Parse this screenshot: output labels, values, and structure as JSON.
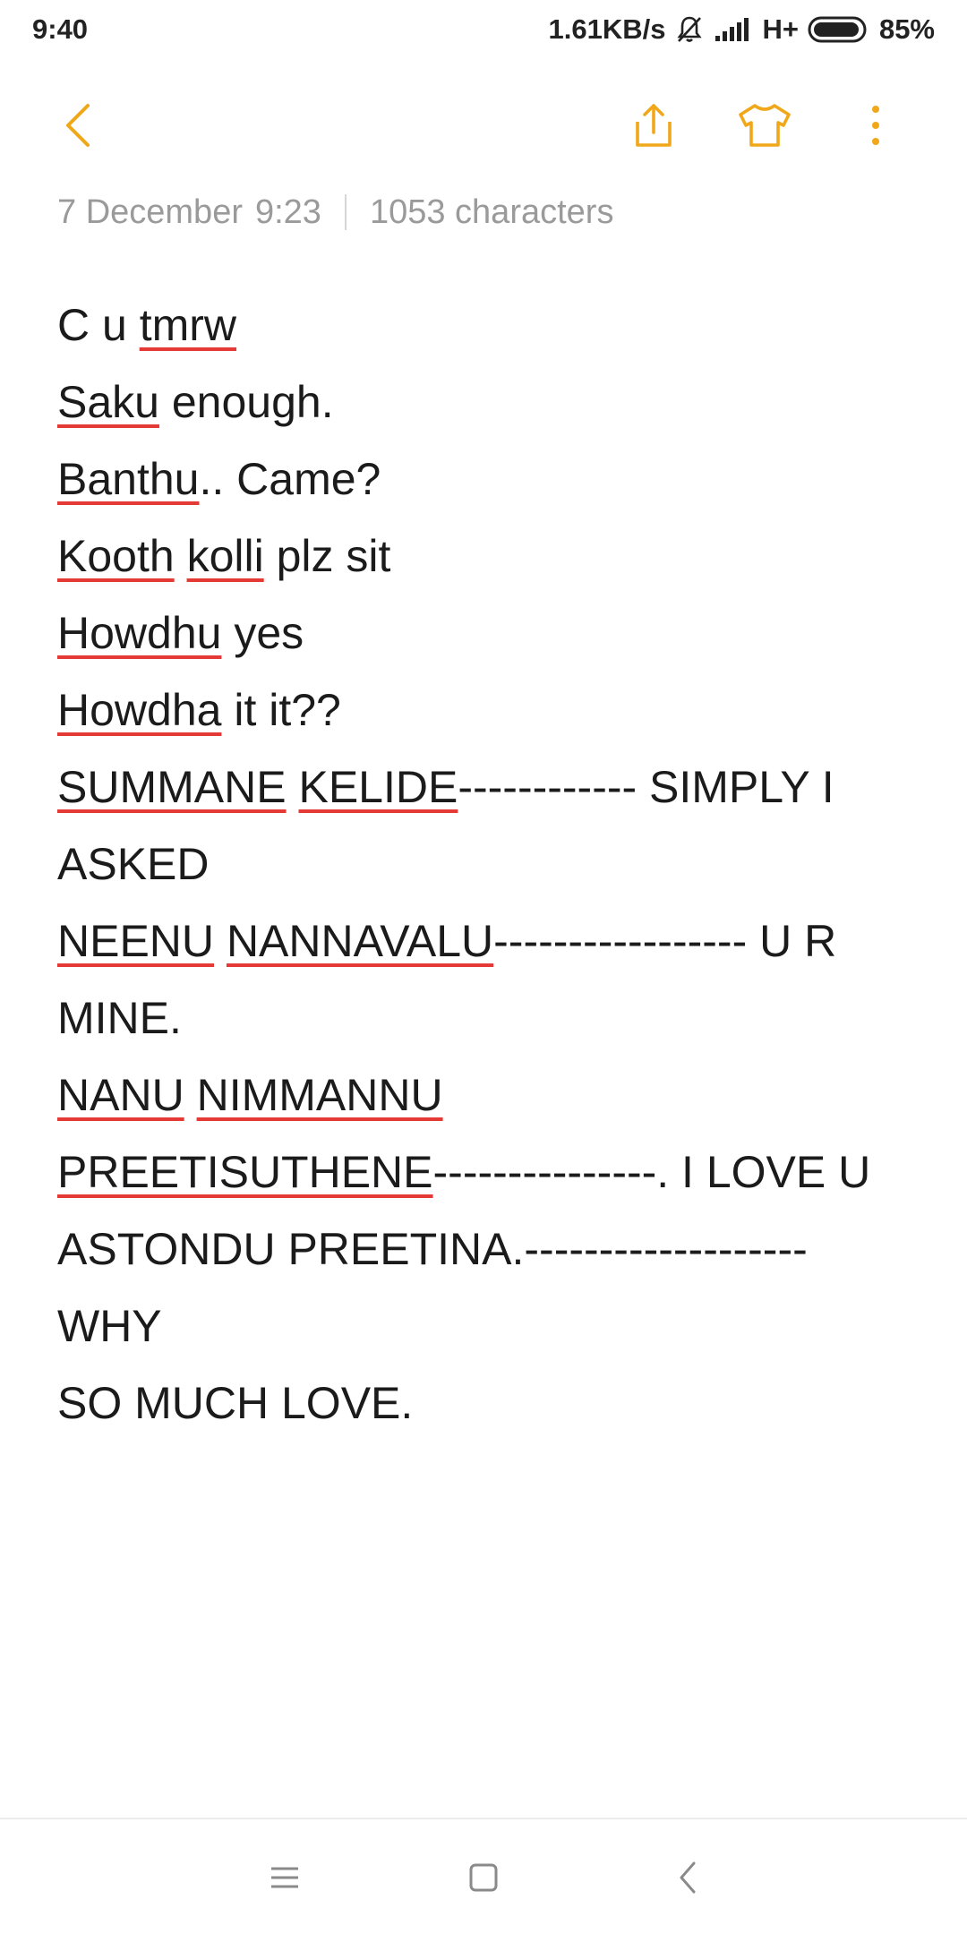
{
  "status_bar": {
    "time": "9:40",
    "net_speed": "1.61KB/s",
    "network_type": "H+",
    "battery": "85%",
    "icons": [
      "bell-muted-icon",
      "signal-icon",
      "battery-icon"
    ]
  },
  "toolbar": {
    "icons": [
      "back-chevron-icon",
      "share-icon",
      "theme-shirt-icon",
      "more-vertical-icon"
    ],
    "accent_color": "#f0a81a"
  },
  "meta": {
    "date": "7 December",
    "time": "9:23",
    "char_count": "1053 characters"
  },
  "note": {
    "l1": {
      "w1": "C u ",
      "w2": "tmrw"
    },
    "l2": {
      "w1": "Saku",
      "w2": " enough."
    },
    "l3": {
      "w1": "Banthu",
      "w2": ".. Came?"
    },
    "l4": {
      "w1": "Kooth",
      "w2": " ",
      "w3": "kolli",
      "w4": " plz sit"
    },
    "l5": {
      "w1": "Howdhu",
      "w2": " yes"
    },
    "l6": {
      "w1": "Howdha",
      "w2": " it it??"
    },
    "l7": {
      "w1": "SUMMANE",
      "w2": " ",
      "w3": "KELIDE",
      "w4": "------------ SIMPLY I"
    },
    "l8": {
      "w1": "ASKED"
    },
    "l9": {
      "w1": "NEENU",
      "w2": " ",
      "w3": "NANNAVALU",
      "w4": "----------------- U R"
    },
    "l10": {
      "w1": "MINE."
    },
    "l11": {
      "w1": "NANU",
      "w2": " ",
      "w3": "NIMMANNU"
    },
    "l12": {
      "w1": "PREETISUTHENE",
      "w2": "---------------. I LOVE U"
    },
    "l13": {
      "w1": "ASTONDU PREETINA.------------------- WHY"
    },
    "l14": {
      "w1": "SO MUCH LOVE."
    }
  },
  "nav_bar": {
    "icons": [
      "menu-icon",
      "home-square-icon",
      "back-icon"
    ]
  }
}
